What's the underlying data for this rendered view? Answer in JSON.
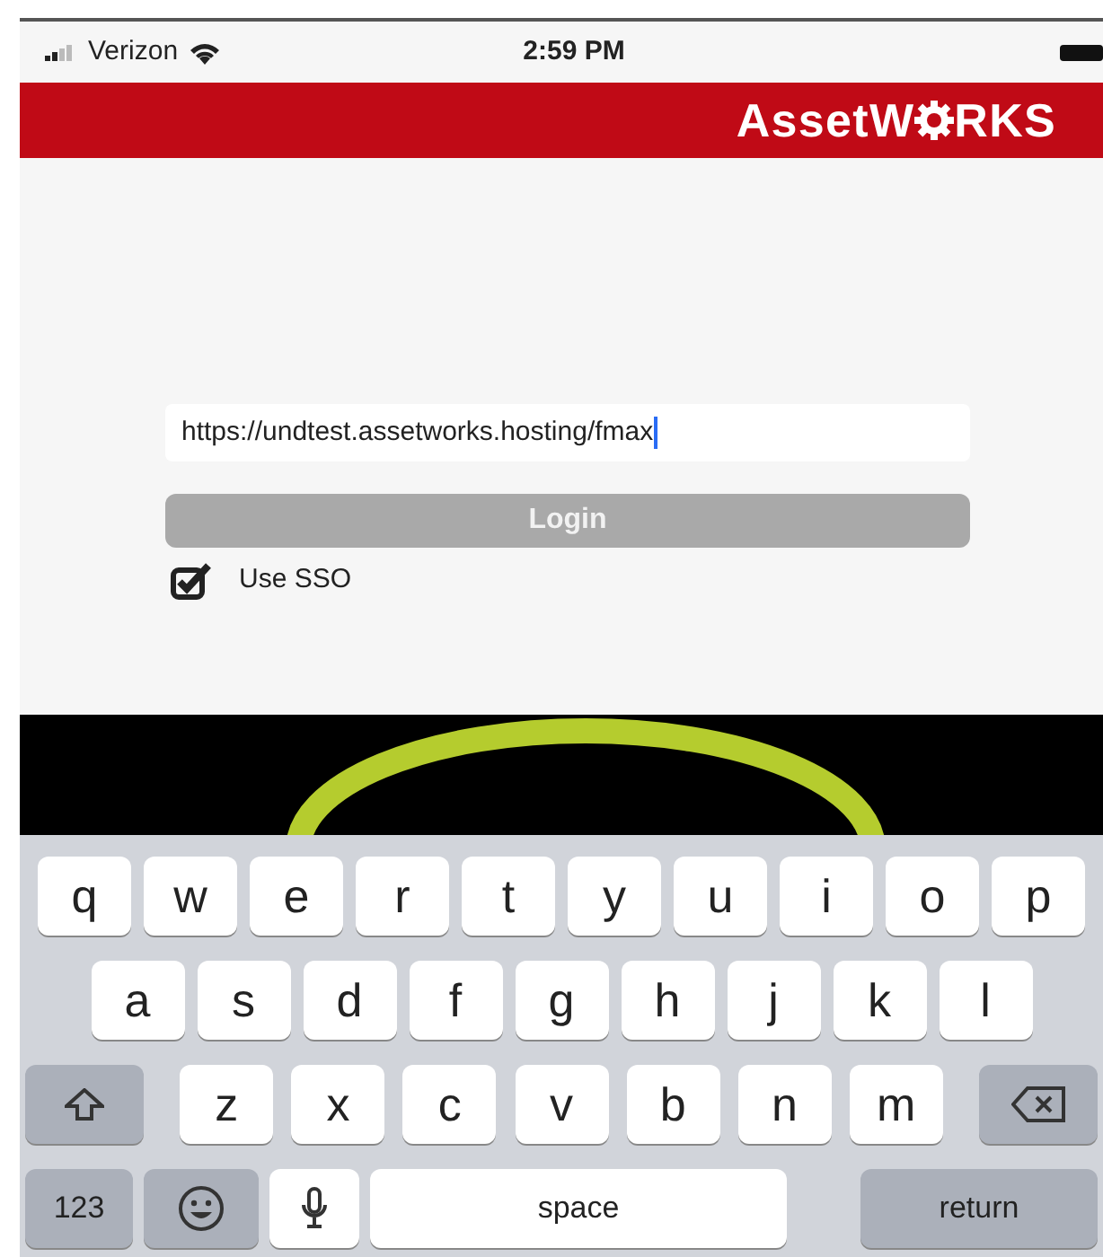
{
  "status_bar": {
    "carrier": "Verizon",
    "time": "2:59 PM"
  },
  "header": {
    "logo_before": "AssetW",
    "logo_after": "RKS"
  },
  "login": {
    "url_field": {
      "value": "https://undtest.assetworks.hosting/fmax",
      "focused": true
    },
    "login_button": "Login",
    "use_sso": {
      "label": "Use SSO",
      "checked": true
    }
  },
  "keyboard": {
    "rows": [
      {
        "keys": [
          {
            "kind": "letter",
            "label": "q"
          },
          {
            "kind": "letter",
            "label": "w"
          },
          {
            "kind": "letter",
            "label": "e"
          },
          {
            "kind": "letter",
            "label": "r"
          },
          {
            "kind": "letter",
            "label": "t"
          },
          {
            "kind": "letter",
            "label": "y"
          },
          {
            "kind": "letter",
            "label": "u"
          },
          {
            "kind": "letter",
            "label": "i"
          },
          {
            "kind": "letter",
            "label": "o"
          },
          {
            "kind": "letter",
            "label": "p"
          }
        ]
      },
      {
        "keys": [
          {
            "kind": "letter",
            "label": "a"
          },
          {
            "kind": "letter",
            "label": "s"
          },
          {
            "kind": "letter",
            "label": "d"
          },
          {
            "kind": "letter",
            "label": "f"
          },
          {
            "kind": "letter",
            "label": "g"
          },
          {
            "kind": "letter",
            "label": "h"
          },
          {
            "kind": "letter",
            "label": "j"
          },
          {
            "kind": "letter",
            "label": "k"
          },
          {
            "kind": "letter",
            "label": "l"
          }
        ]
      },
      {
        "keys": [
          {
            "kind": "shift"
          },
          {
            "kind": "letter",
            "label": "z"
          },
          {
            "kind": "letter",
            "label": "x"
          },
          {
            "kind": "letter",
            "label": "c"
          },
          {
            "kind": "letter",
            "label": "v"
          },
          {
            "kind": "letter",
            "label": "b"
          },
          {
            "kind": "letter",
            "label": "n"
          },
          {
            "kind": "letter",
            "label": "m"
          },
          {
            "kind": "delete"
          }
        ]
      },
      {
        "keys": [
          {
            "kind": "numbers",
            "label": "123"
          },
          {
            "kind": "emoji"
          },
          {
            "kind": "mic"
          },
          {
            "kind": "space",
            "label": "space"
          },
          {
            "kind": "return",
            "label": "return"
          }
        ]
      }
    ]
  }
}
